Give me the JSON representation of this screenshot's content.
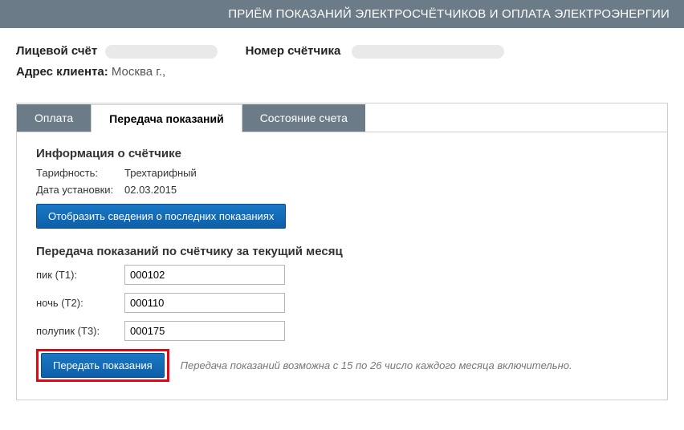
{
  "header": {
    "title": "ПРИЁМ ПОКАЗАНИЙ ЭЛЕКТРОСЧЁТЧИКОВ И ОПЛАТА ЭЛЕКТРОЭНЕРГИИ"
  },
  "account": {
    "account_label": "Лицевой счёт",
    "meter_label": "Номер счётчика",
    "address_label": "Адрес клиента:",
    "address_value": "Москва г.,"
  },
  "tabs": {
    "payment": "Оплата",
    "submit": "Передача показаний",
    "status": "Состояние счета"
  },
  "meter_info": {
    "title": "Информация о счётчике",
    "tariff_label": "Тарифность:",
    "tariff_value": "Трехтарифный",
    "install_label": "Дата установки:",
    "install_value": "02.03.2015",
    "btn_history": "Отобразить сведения о последних показаниях"
  },
  "readings": {
    "title": "Передача показаний по счётчику за текущий месяц",
    "t1_label": "пик (T1):",
    "t1_value": "000102",
    "t2_label": "ночь (T2):",
    "t2_value": "000110",
    "t3_label": "полупик (T3):",
    "t3_value": "000175",
    "submit_btn": "Передать показания",
    "note": "Передача показаний возможна с 15 по 26 число каждого месяца включительно."
  }
}
